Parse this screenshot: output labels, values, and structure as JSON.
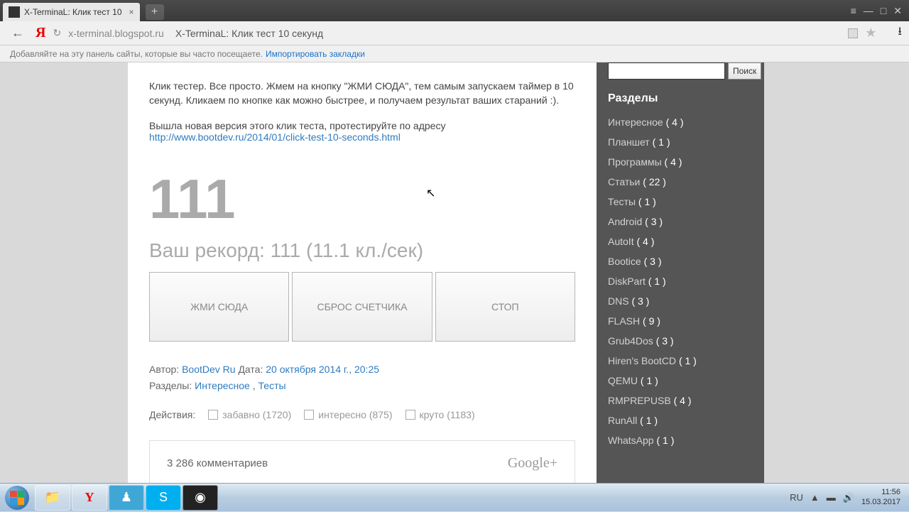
{
  "browser": {
    "tab_title": "X-TerminaL: Клик тест 10",
    "new_tab": "+",
    "menu": "≡",
    "minimize": "—",
    "maximize": "□",
    "close": "✕",
    "back": "←",
    "logo": "Я",
    "reload": "↻",
    "url_host": "x-terminal.blogspot.ru",
    "page_title": "X-TerminaL: Клик тест 10 секунд",
    "bookmark_hint": "Добавляйте на эту панель сайты, которые вы часто посещаете.",
    "import_bookmarks": "Импортировать закладки",
    "star": "★",
    "download": "⭳"
  },
  "main": {
    "intro": "Клик тестер. Все просто. Жмем на кнопку \"ЖМИ СЮДА\", тем самым запускаем таймер в 10 секунд. Кликаем по кнопке как можно быстрее, и получаем результат ваших стараний :).",
    "newver_prefix": "Вышла новая версия этого клик теста, протестируйте по адресу ",
    "newver_link": "http://www.bootdev.ru/2014/01/click-test-10-seconds.html",
    "big_number": "111",
    "record": "Ваш рекорд: 111 (11.1 кл./сек)",
    "btn_click": "ЖМИ СЮДА",
    "btn_reset": "СБРОС СЧЕТЧИКА",
    "btn_stop": "СТОП",
    "author_label": "Автор: ",
    "author": "BootDev Ru",
    "date_label": " Дата: ",
    "date": "20 октября 2014 г., 20:25",
    "sections_label": "Разделы: ",
    "section1": "Интересное",
    "section_comma": " , ",
    "section2": "Тесты",
    "actions_label": "Действия:",
    "act_funny": "забавно (1720)",
    "act_interesting": "интересно  (875)",
    "act_cool": "круто (1183)",
    "comments_count": "3 286 комментариев",
    "gplus": "Google+"
  },
  "sidebar": {
    "search_btn": "Поиск",
    "title": "Разделы",
    "cats": [
      {
        "name": "Интересное",
        "count": "( 4 )"
      },
      {
        "name": "Планшет",
        "count": "( 1 )"
      },
      {
        "name": "Программы",
        "count": "( 4 )"
      },
      {
        "name": "Статьи",
        "count": "( 22 )"
      },
      {
        "name": "Тесты",
        "count": "( 1 )"
      },
      {
        "name": "Android",
        "count": "( 3 )"
      },
      {
        "name": "AutoIt",
        "count": "( 4 )"
      },
      {
        "name": "Bootice",
        "count": "( 3 )"
      },
      {
        "name": "DiskPart",
        "count": "( 1 )"
      },
      {
        "name": "DNS",
        "count": "( 3 )"
      },
      {
        "name": "FLASH",
        "count": "( 9 )"
      },
      {
        "name": "Grub4Dos",
        "count": "( 3 )"
      },
      {
        "name": "Hiren's BootCD",
        "count": "( 1 )"
      },
      {
        "name": "QEMU",
        "count": "( 1 )"
      },
      {
        "name": "RMPREPUSB",
        "count": "( 4 )"
      },
      {
        "name": "RunAll",
        "count": "( 1 )"
      },
      {
        "name": "WhatsApp",
        "count": "( 1 )"
      }
    ]
  },
  "taskbar": {
    "lang": "RU",
    "time": "11:56",
    "date": "15.03.2017"
  }
}
